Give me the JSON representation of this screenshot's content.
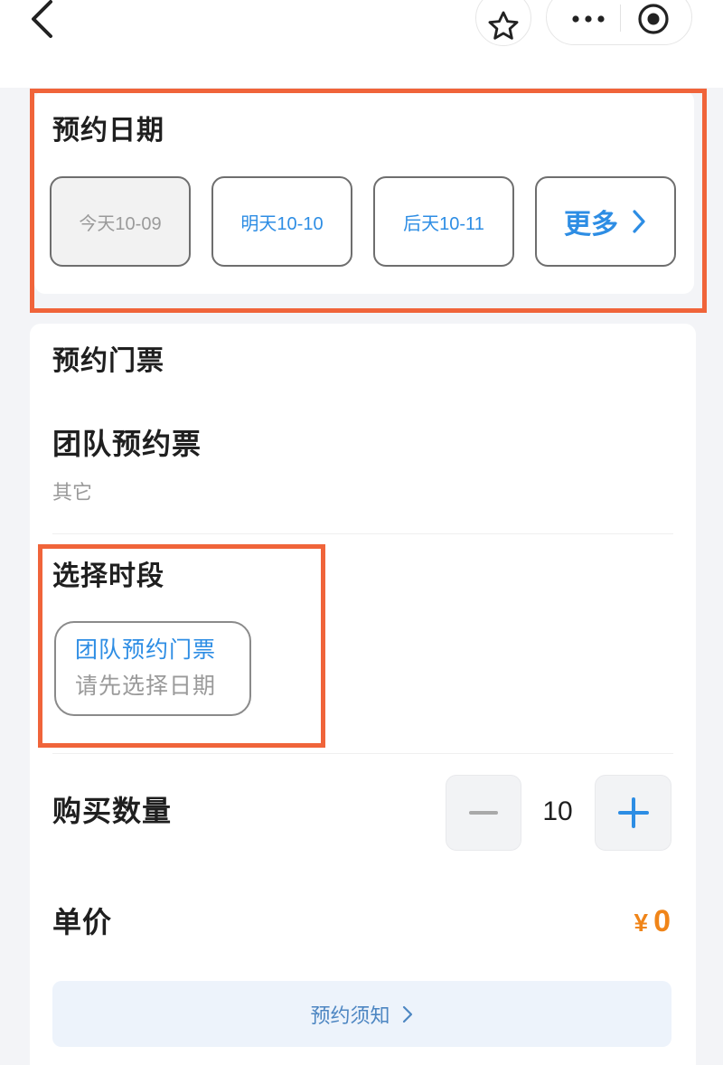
{
  "nav": {
    "icons": {
      "back": "chevron-left-icon",
      "favorite": "star-icon",
      "more": "more-dots-icon",
      "record": "record-icon"
    }
  },
  "date_section": {
    "title": "预约日期",
    "options": [
      {
        "label": "今天10-09",
        "disabled": true
      },
      {
        "label": "明天10-10",
        "disabled": false
      },
      {
        "label": "后天10-11",
        "disabled": false
      }
    ],
    "more_label": "更多",
    "more_icon": "chevron-right-icon"
  },
  "ticket_section": {
    "title": "预约门票",
    "ticket_name": "团队预约票",
    "ticket_category": "其它"
  },
  "time_slot_section": {
    "title": "选择时段",
    "slot": {
      "name": "团队预约门票",
      "hint": "请先选择日期"
    }
  },
  "quantity": {
    "label": "购买数量",
    "value": "10",
    "minus_icon": "minus-icon",
    "plus_icon": "plus-icon"
  },
  "price": {
    "label": "单价",
    "currency": "¥",
    "amount": "0"
  },
  "notice": {
    "label": "预约须知",
    "icon": "chevron-right-icon"
  },
  "colors": {
    "accent_blue": "#2d8de4",
    "price_orange": "#f08519",
    "highlight_orange": "#f0643a",
    "page_background": "#f3f4f7"
  }
}
